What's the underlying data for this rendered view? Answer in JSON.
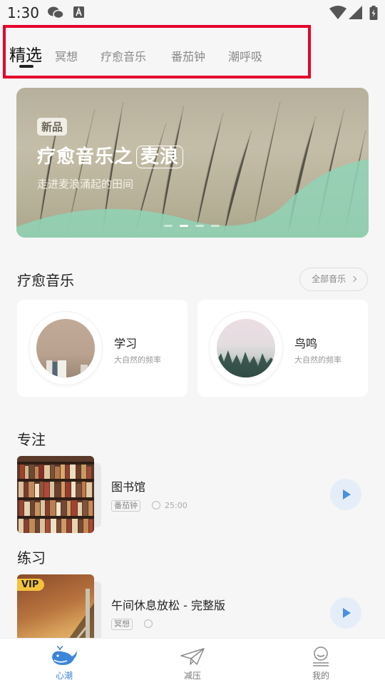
{
  "status_bar": {
    "time": "1:30",
    "icons": [
      "wechat-icon",
      "text-a-icon",
      "wifi-icon",
      "signal-icon",
      "battery-icon"
    ]
  },
  "tabs": [
    {
      "label": "精选",
      "active": true
    },
    {
      "label": "冥想",
      "active": false
    },
    {
      "label": "疗愈音乐",
      "active": false
    },
    {
      "label": "番茄钟",
      "active": false
    },
    {
      "label": "潮呼吸",
      "active": false
    }
  ],
  "banner": {
    "badge": "新品",
    "title_prefix": "疗愈音乐之",
    "title_highlight": "麦浪",
    "subtitle": "走进麦浪涌起的田间",
    "page_count": 4,
    "active_page": 1
  },
  "healing_music": {
    "title": "疗愈音乐",
    "all_label": "全部音乐",
    "items": [
      {
        "name": "学习",
        "desc": "大自然的频率"
      },
      {
        "name": "鸟鸣",
        "desc": "大自然的频率"
      }
    ]
  },
  "focus": {
    "title": "专注",
    "track": {
      "name": "图书馆",
      "tag": "番茄钟",
      "duration": "25:00"
    }
  },
  "practice": {
    "title": "练习",
    "track": {
      "name": "午间休息放松 - 完整版",
      "tag": "冥想",
      "badge": "VIP"
    }
  },
  "bottom_nav": [
    {
      "label": "心潮",
      "icon": "whale-icon",
      "active": true
    },
    {
      "label": "减压",
      "icon": "paper-plane-icon",
      "active": false
    },
    {
      "label": "我的",
      "icon": "profile-icon",
      "active": false
    }
  ],
  "colors": {
    "accent": "#3b86d8",
    "annotation": "#e4002b",
    "banner_green": "#8fd3b6",
    "vip": "#f4c33c"
  }
}
